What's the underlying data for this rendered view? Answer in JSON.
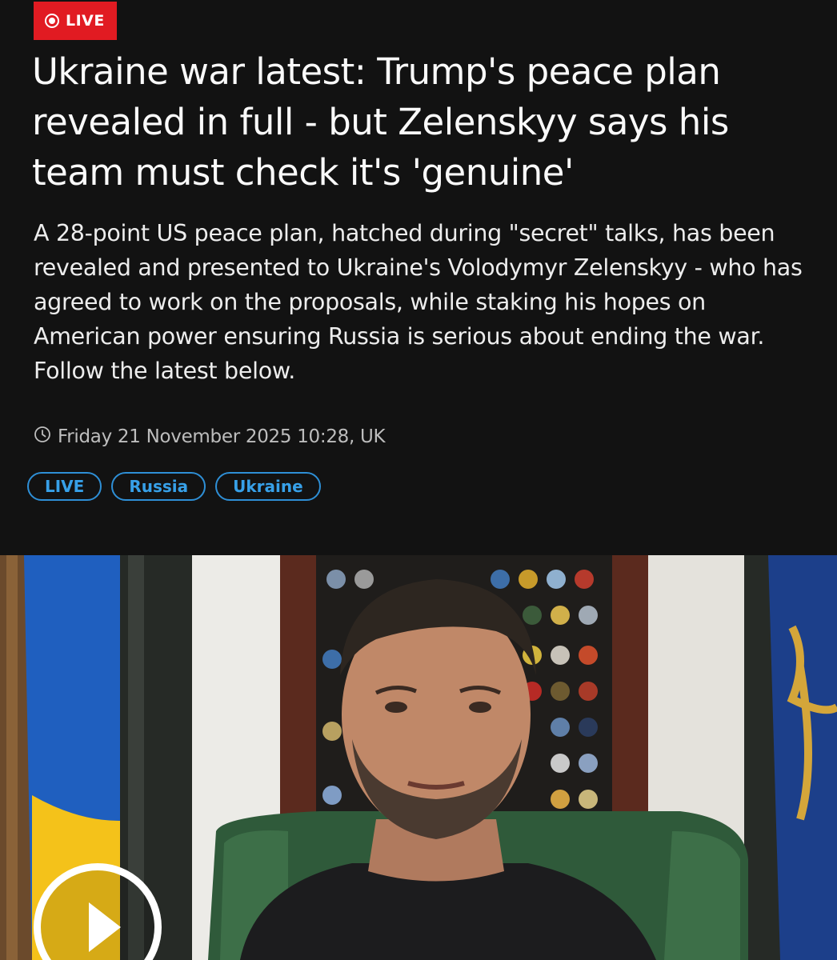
{
  "badge": {
    "label": "LIVE"
  },
  "article": {
    "headline": "Ukraine war latest: Trump's peace plan revealed in full - but Zelenskyy says his team must check it's 'genuine'",
    "summary": "A 28-point US peace plan, hatched during \"secret\" talks, has been revealed and presented to Ukraine's Volodymyr Zelenskyy - who has agreed to work on the proposals, while staking his hopes on American power ensuring Russia is serious about ending the war. Follow the latest below.",
    "timestamp": "Friday 21 November 2025 10:28, UK",
    "timestamp_icon": "clock-icon"
  },
  "tags": [
    {
      "label": "LIVE"
    },
    {
      "label": "Russia"
    },
    {
      "label": "Ukraine"
    }
  ],
  "video": {
    "play_icon": "play-icon"
  },
  "colors": {
    "background": "#121212",
    "live_red": "#e11b22",
    "tag_blue": "#37a0e8"
  }
}
